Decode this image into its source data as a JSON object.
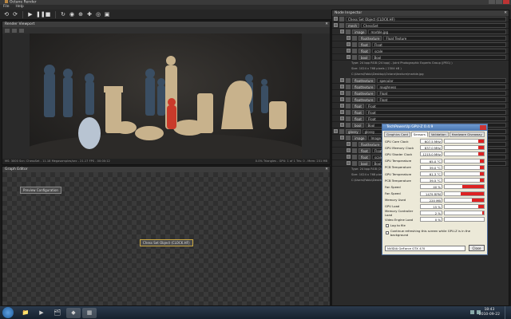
{
  "window": {
    "title": "Octane Render"
  },
  "menu": [
    "File",
    "Help"
  ],
  "viewport": {
    "title": "Render Viewport",
    "status_left": "MS: 3000  Scn: ChessSet  -  11.18  Megasamples/sec  -  21.17 FPS  -  00:00:12",
    "status_right": "0.0% Triangles  -  GPU: 1 of 1  Tris: 0  -  Mem: 231 MB"
  },
  "graph_editor": {
    "title": "Graph Editor",
    "preview_node": "Preview Configuration",
    "mesh_node": "Chess Set Object (CLOCK.HF)"
  },
  "scene_inspector": {
    "title": "Node Inspector",
    "header_value": "Chess Set Object (CLOCK.HF)",
    "rows": [
      {
        "type": "mesh",
        "value": "ChessSet",
        "indent": 0
      },
      {
        "type": "image",
        "value": "marble.jpg",
        "indent": 1
      },
      {
        "type": "floattexture",
        "value": "Float Texture",
        "indent": 2
      },
      {
        "type": "float",
        "value": "Float",
        "indent": 2
      },
      {
        "type": "float",
        "value": "scale",
        "indent": 2
      },
      {
        "type": "bool",
        "value": "Bool",
        "indent": 2
      }
    ],
    "info_lines": [
      "Type:    24 bpp RGB (24 bpp) - Joint Photographic Experts Group (JPEG) )",
      "Size:    1024 x 768 pixels ( 2304 kB )",
      "C:\\Users\\Fabio\\Desktop\\Octane\\texture\\marble.jpg"
    ],
    "rows2": [
      {
        "type": "floattexture",
        "value": "specular",
        "indent": 1
      },
      {
        "type": "floattexture",
        "value": "roughness",
        "indent": 1
      },
      {
        "type": "floattexture",
        "value": "Float",
        "indent": 1
      },
      {
        "type": "floattexture",
        "value": "Float",
        "indent": 1
      },
      {
        "type": "float",
        "value": "Float",
        "indent": 1
      },
      {
        "type": "float",
        "value": "Float",
        "indent": 1
      },
      {
        "type": "float",
        "value": "Float",
        "indent": 1
      },
      {
        "type": "bool",
        "value": "Bool",
        "indent": 1
      },
      {
        "type": "glossy",
        "value": "glossy",
        "indent": 0
      },
      {
        "type": "image",
        "value": "Image",
        "indent": 1
      },
      {
        "type": "floattexture",
        "value": "Float Texture",
        "indent": 2
      },
      {
        "type": "float",
        "value": "Float",
        "indent": 2
      },
      {
        "type": "float",
        "value": "scale",
        "indent": 2
      },
      {
        "type": "bool",
        "value": "Bool",
        "indent": 2
      }
    ],
    "info_lines2": [
      "Type:    24 bpp RGB (24 bpp) - Joint Photographic Experts Group (JPEG) )",
      "Size:    1024 x 768 pixels ( 2304 kB )",
      "C:\\Users\\Fabio\\Desktop\\Octane\\texture\\wood.jpg"
    ]
  },
  "gpuz": {
    "title": "TechPowerUp GPU-Z 0.4.9",
    "tabs": [
      "Graphics Card",
      "Sensors",
      "Validation",
      "Hardware Giveaway"
    ],
    "active_tab": "Sensors",
    "sensors": [
      {
        "label": "GPU Core Clock",
        "value": "607.5 MHz",
        "fill": 0.15
      },
      {
        "label": "GPU Memory Clock",
        "value": "837.0 MHz",
        "fill": 0.15
      },
      {
        "label": "GPU Shader Clock",
        "value": "1215.0 MHz",
        "fill": 0.15
      },
      {
        "label": "GPU Temperature",
        "value": "65.0 °C",
        "fill": 0.1
      },
      {
        "label": "PCB Temperature",
        "value": "39.0 °C",
        "fill": 0.1
      },
      {
        "label": "GPU Temperature",
        "value": "61.3 °C",
        "fill": 0.1
      },
      {
        "label": "PCB Temperature",
        "value": "39.5 °C",
        "fill": 0.1
      },
      {
        "label": "Fan Speed",
        "value": "40 %",
        "fill": 0.55
      },
      {
        "label": "Fan Speed",
        "value": "1479 RPM",
        "fill": 0.6
      },
      {
        "label": "Memory Used",
        "value": "220 MB",
        "fill": 0.3
      },
      {
        "label": "GPU Load",
        "value": "15 %",
        "fill": 0.15
      },
      {
        "label": "Memory Controller Load",
        "value": "2 %",
        "fill": 0.05
      },
      {
        "label": "Video Engine Load",
        "value": "0 %",
        "fill": 0.0
      }
    ],
    "log_label": "Log to file",
    "continue_label": "Continue refreshing this screen while GPU-Z is in the background",
    "device": "NVIDIA GeForce GTX 470",
    "close_label": "Close"
  },
  "taskbar": {
    "time": "18:43",
    "date": "2010-09-22"
  }
}
